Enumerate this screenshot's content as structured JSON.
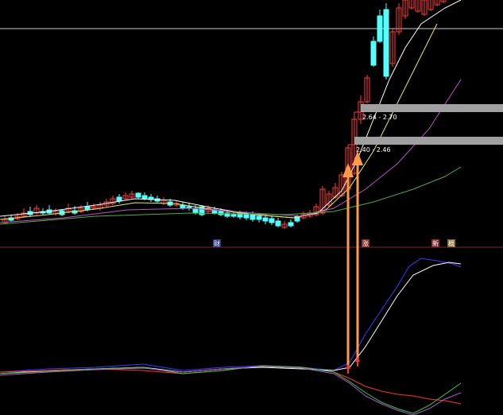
{
  "colors": {
    "background": "#000000",
    "up_candle": "#ff3b3b",
    "down_candle": "#54ffff",
    "separator": "#8a1f2a",
    "top_line": "#c8c8c8",
    "band": "#a0a0a0",
    "arrow": "#ff9a4a",
    "ma_white": "#ffffff",
    "ma_yellow": "#e6e66e",
    "ma_magenta": "#c050c8",
    "ma_green": "#4caf3a",
    "osc_blue": "#3a3aff",
    "osc_white": "#ffffff",
    "osc_red": "#ff3030",
    "osc_green": "#3cd03c",
    "osc_purple": "#b05ad0"
  },
  "price_bands": [
    {
      "label": "2.64 - 2.70"
    },
    {
      "label": "2.40 - 2.46"
    }
  ],
  "event_markers": [
    {
      "label": "财",
      "icon": "info-mark-icon"
    },
    {
      "label": "涨",
      "icon": "info-mark-icon"
    },
    {
      "label": "新",
      "icon": "info-mark-icon"
    },
    {
      "label": "概",
      "icon": "info-mark-icon"
    }
  ],
  "signal_arrows": [
    {
      "icon": "up-arrow-icon"
    },
    {
      "icon": "up-arrow-icon"
    }
  ]
}
